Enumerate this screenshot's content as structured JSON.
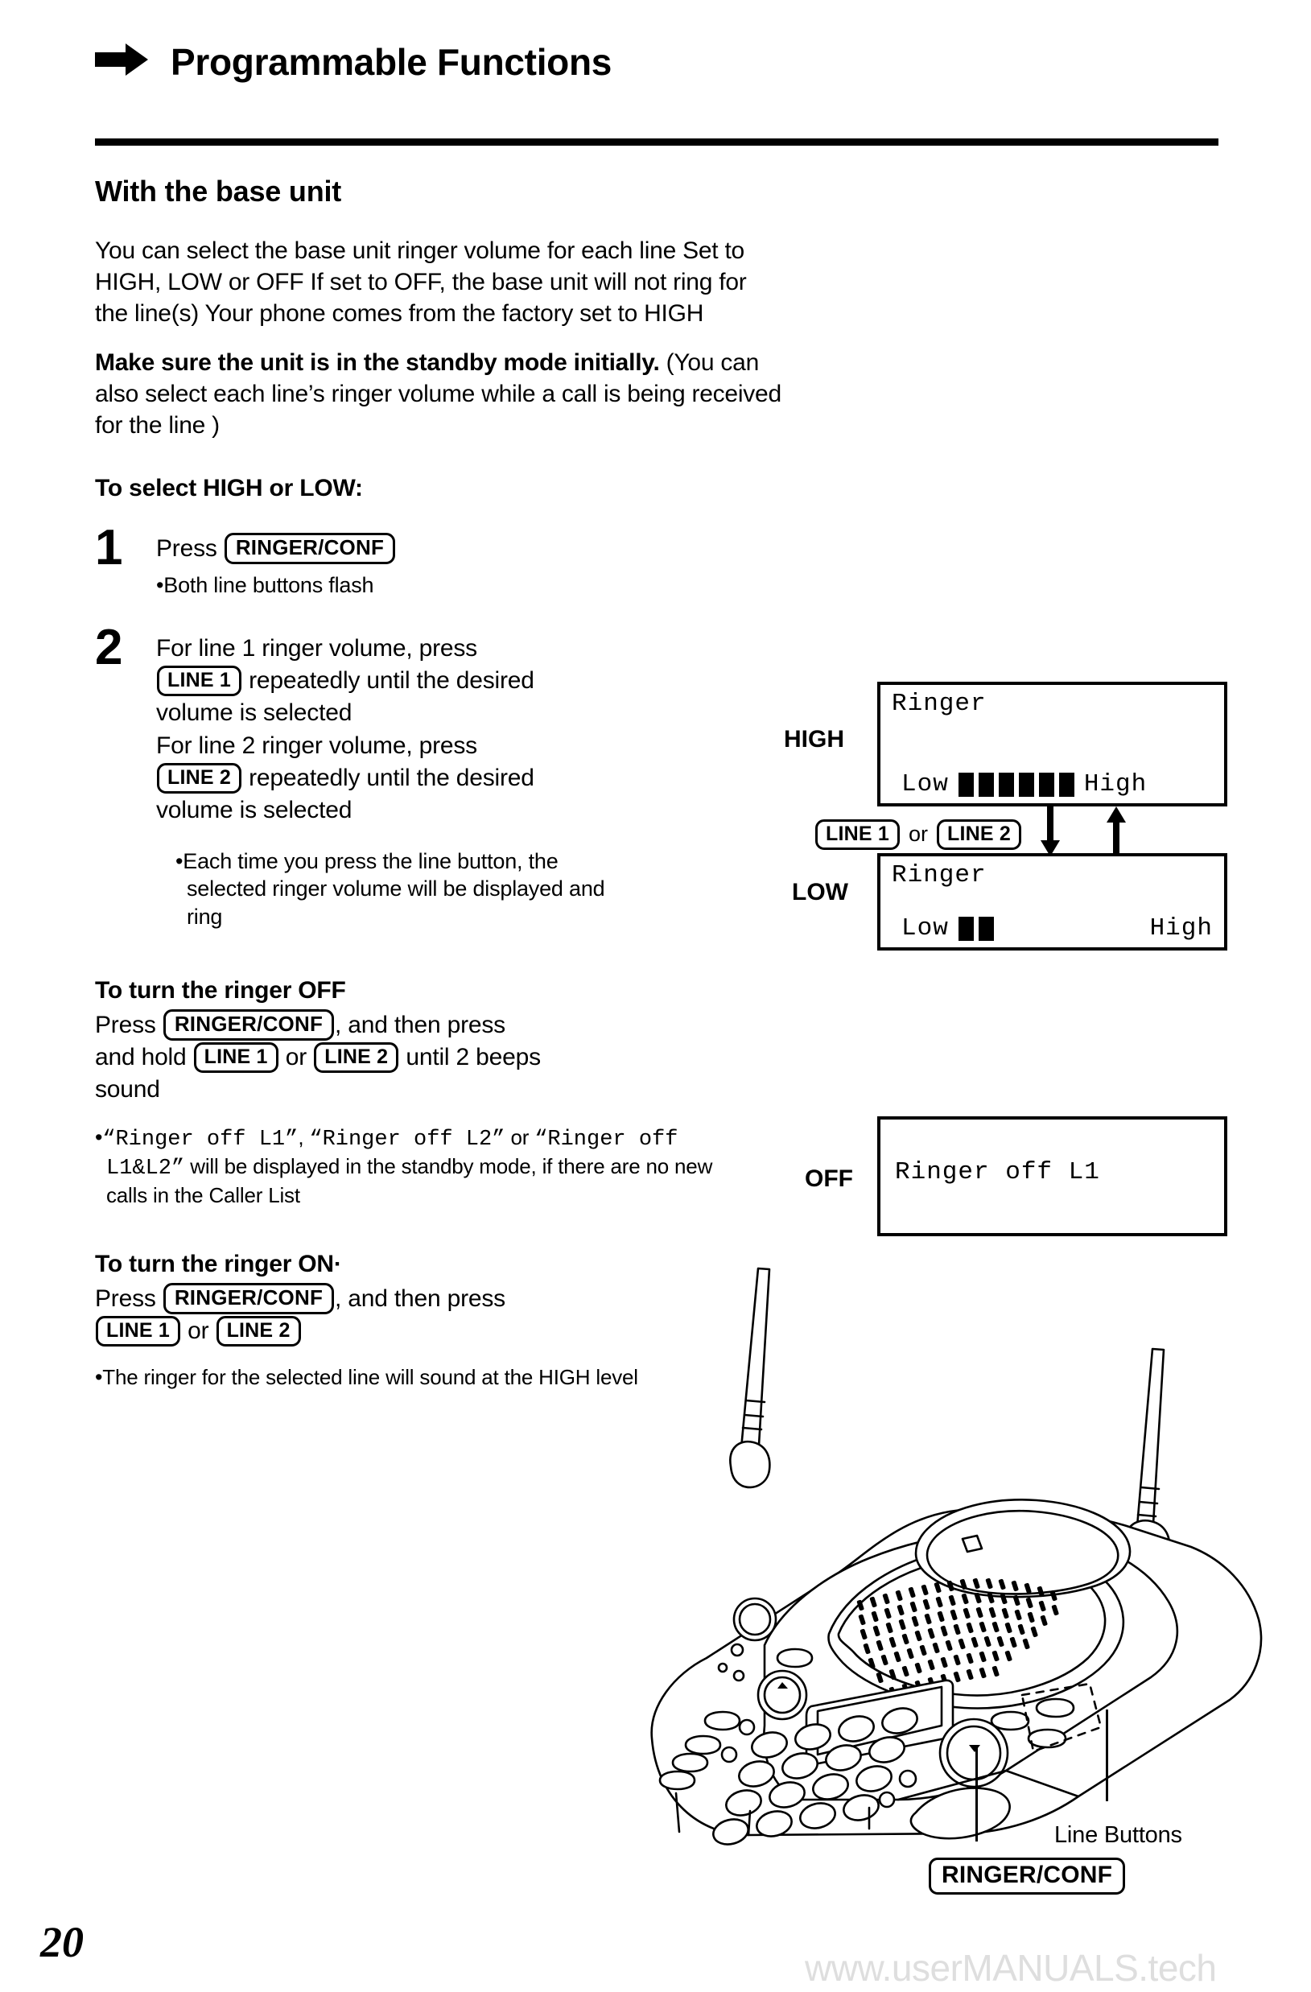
{
  "header": {
    "arrow_icon": "right-arrow-icon",
    "title": "Programmable Functions"
  },
  "section": {
    "heading": "With the base unit",
    "intro_p1": "You can select the base unit ringer volume for each line  Set to HIGH, LOW or OFF  If set to OFF, the base unit will not ring for the line(s)  Your phone comes from the factory set to HIGH",
    "intro_p2_bold": "Make sure the unit is in the standby mode initially.",
    "intro_p2_rest": " (You can also select each line’s ringer volume while a call is being received for the line )"
  },
  "select_high_low": {
    "heading": "To select HIGH or LOW:",
    "step1": {
      "number": "1",
      "press_label": "Press",
      "key": "RINGER/CONF",
      "bullet": "Both line buttons flash"
    },
    "step2": {
      "number": "2",
      "line1a": "For line 1 ringer volume, press",
      "key1": "LINE 1",
      "line1b": "repeatedly until the desired",
      "line1c": "volume is selected",
      "line2a": "For line 2 ringer volume, press",
      "key2": "LINE 2",
      "line2b": "repeatedly until the desired",
      "line2c": "volume is selected",
      "bullet": "Each time you press the line button, the selected ringer volume will be displayed and ring"
    }
  },
  "displays": {
    "high": {
      "side_label": "HIGH",
      "line1": "Ringer",
      "low_label": "Low",
      "high_label": "High",
      "bars": 6
    },
    "low": {
      "side_label": "LOW",
      "line1": "Ringer",
      "low_label": "Low",
      "high_label": "High",
      "bars": 2
    },
    "off": {
      "side_label": "OFF",
      "line1": "Ringer off L1"
    },
    "middle_row": {
      "key1": "LINE 1",
      "or": "or",
      "key2": "LINE 2",
      "arrow_down_icon": "arrow-down-icon",
      "arrow_up_icon": "arrow-up-icon"
    }
  },
  "ringer_off": {
    "heading": "To turn the ringer OFF",
    "press_label": "Press",
    "key_ringer": "RINGER/CONF",
    "text_after_key": ", and then press",
    "and_hold": "and hold",
    "key_line1": "LINE 1",
    "or": "or",
    "key_line2": "LINE 2",
    "until": "until 2 beeps",
    "sound": "sound",
    "bullet_mono1": "“Ringer off L1”",
    "bullet_sep1": ", ",
    "bullet_mono2": "“Ringer off L2”",
    "bullet_or": " or",
    "bullet_mono3": "“Ringer off L1&L2”",
    "bullet_rest": " will be displayed in the standby mode, if there are no new calls in the Caller List"
  },
  "ringer_on": {
    "heading": "To turn the ringer ON·",
    "press_label": "Press",
    "key_ringer": "RINGER/CONF",
    "text_after_key": ", and then press",
    "key_line1": "LINE 1",
    "or": "or",
    "key_line2": "LINE 2",
    "bullet": "The ringer for the selected line will sound at the HIGH level"
  },
  "illustration": {
    "device": "cordless-phone-base-unit",
    "callout_line_buttons": "Line Buttons",
    "callout_ringer_conf": "RINGER/CONF"
  },
  "footer": {
    "page_number": "20",
    "watermark": "www.userMANUALS.tech"
  }
}
